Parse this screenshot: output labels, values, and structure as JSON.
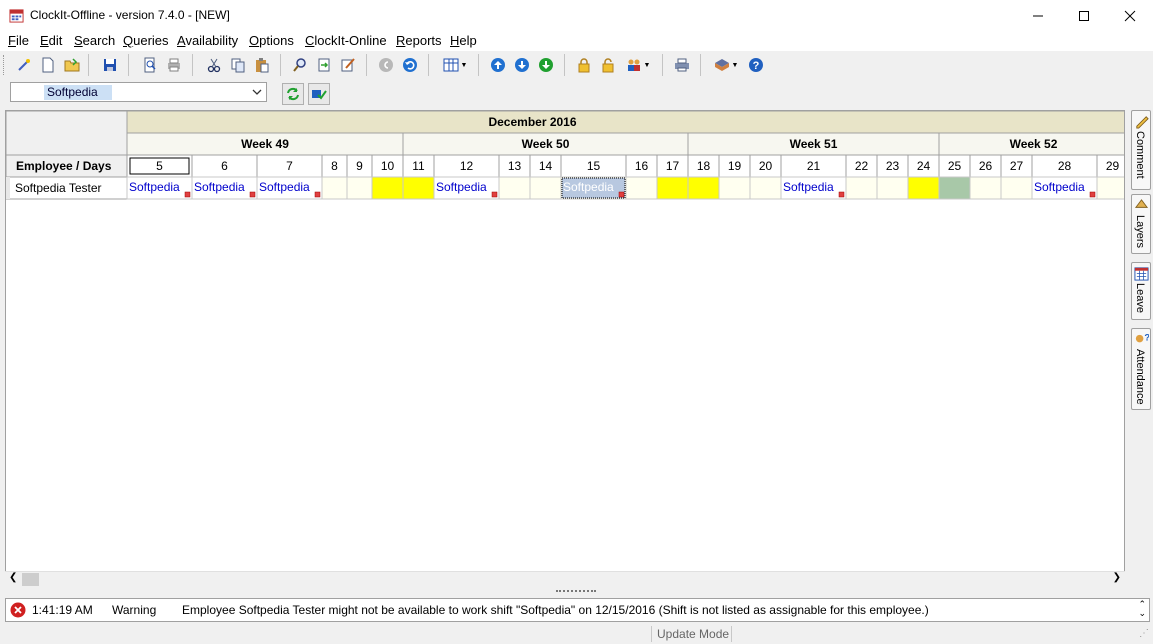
{
  "window": {
    "title": "ClockIt-Offline - version  7.4.0 - [NEW]"
  },
  "menu": [
    {
      "label": "File",
      "key": "F"
    },
    {
      "label": "Edit",
      "key": "E"
    },
    {
      "label": "Search",
      "key": "S"
    },
    {
      "label": "Queries",
      "key": "Q"
    },
    {
      "label": "Availability",
      "key": "A"
    },
    {
      "label": "Options",
      "key": "O"
    },
    {
      "label": "ClockIt-Online",
      "key": "C"
    },
    {
      "label": "Reports",
      "key": "R"
    },
    {
      "label": "Help",
      "key": "H"
    }
  ],
  "toolbar": {
    "icons": [
      "wizard-icon",
      "new-icon",
      "open-icon",
      "save-icon",
      "print-preview-icon",
      "print-icon",
      "cut-icon",
      "copy-icon",
      "paste-icon",
      "find-icon",
      "replace-icon",
      "edit-icon",
      "back-icon",
      "undo-icon",
      "grid-view-icon",
      "up-icon",
      "down-icon",
      "download-icon",
      "lock-icon",
      "unlock-icon",
      "people-icon",
      "printer-icon",
      "tag-icon",
      "help-icon"
    ]
  },
  "filter": {
    "selected": "Softpedia"
  },
  "schedule": {
    "month": "December 2016",
    "weeks": [
      {
        "label": "Week 49"
      },
      {
        "label": "Week 50"
      },
      {
        "label": "Week 51"
      },
      {
        "label": "Week 52"
      }
    ],
    "row_header_label": "Employee / Days",
    "days": [
      "5",
      "6",
      "7",
      "8",
      "9",
      "10",
      "11",
      "12",
      "13",
      "14",
      "15",
      "16",
      "17",
      "18",
      "19",
      "20",
      "21",
      "22",
      "23",
      "24",
      "25",
      "26",
      "27",
      "28",
      "29"
    ],
    "employees": [
      {
        "name": "Softpedia Tester",
        "cells": [
          {
            "text": "Softpedia",
            "state": "shift"
          },
          {
            "text": "Softpedia",
            "state": "shift"
          },
          {
            "text": "Softpedia",
            "state": "shift"
          },
          {
            "text": "",
            "state": "empty"
          },
          {
            "text": "",
            "state": "empty"
          },
          {
            "text": "",
            "state": "weekend"
          },
          {
            "text": "",
            "state": "weekend"
          },
          {
            "text": "Softpedia",
            "state": "shift"
          },
          {
            "text": "",
            "state": "empty"
          },
          {
            "text": "",
            "state": "empty"
          },
          {
            "text": "Softpedia",
            "state": "selected"
          },
          {
            "text": "",
            "state": "empty"
          },
          {
            "text": "",
            "state": "weekend"
          },
          {
            "text": "",
            "state": "weekend"
          },
          {
            "text": "",
            "state": "empty"
          },
          {
            "text": "",
            "state": "empty"
          },
          {
            "text": "Softpedia",
            "state": "shift"
          },
          {
            "text": "",
            "state": "empty"
          },
          {
            "text": "",
            "state": "empty"
          },
          {
            "text": "",
            "state": "weekend"
          },
          {
            "text": "",
            "state": "holiday"
          },
          {
            "text": "",
            "state": "empty"
          },
          {
            "text": "",
            "state": "empty"
          },
          {
            "text": "Softpedia",
            "state": "shift"
          },
          {
            "text": "",
            "state": "empty"
          }
        ]
      }
    ],
    "colors": {
      "shift_text": "#0000cc",
      "weekend": "#ffff00",
      "holiday": "#a8c8a8",
      "empty": "#fffff0",
      "header": "#ece9d8",
      "month": "#e8e4c8"
    }
  },
  "message": {
    "time": "1:41:19 AM",
    "level": "Warning",
    "text": "Employee Softpedia Tester might not be available to work shift \"Softpedia\" on 12/15/2016 (Shift is not listed as assignable for this employee.)"
  },
  "status": {
    "mode": "Update Mode"
  },
  "sidetabs": [
    {
      "label": "Comment",
      "icon": "comment-icon"
    },
    {
      "label": "Layers",
      "icon": "layers-icon"
    },
    {
      "label": "Leave",
      "icon": "calendar-icon"
    },
    {
      "label": "Attendance",
      "icon": "attendance-icon"
    }
  ]
}
